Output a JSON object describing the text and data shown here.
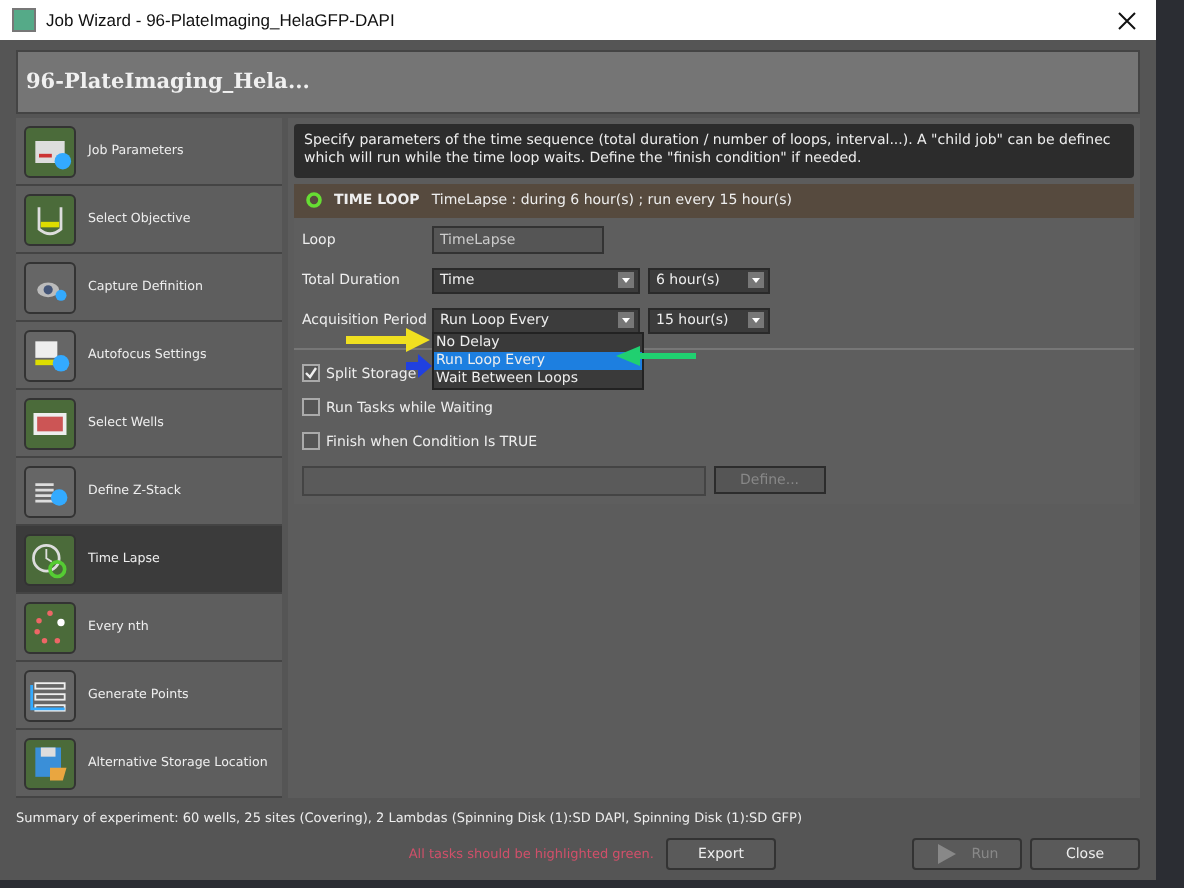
{
  "window": {
    "title": "Job Wizard - 96-PlateImaging_HelaGFP-DAPI"
  },
  "header": "96-PlateImaging_Hela...",
  "sidebar": {
    "items": [
      {
        "label": "Job Parameters",
        "complete": true,
        "selected": false
      },
      {
        "label": "Select Objective",
        "complete": true,
        "selected": false
      },
      {
        "label": "Capture Definition",
        "complete": false,
        "selected": false
      },
      {
        "label": "Autofocus Settings",
        "complete": false,
        "selected": false
      },
      {
        "label": "Select Wells",
        "complete": true,
        "selected": false
      },
      {
        "label": "Define Z-Stack",
        "complete": false,
        "selected": false
      },
      {
        "label": "Time Lapse",
        "complete": true,
        "selected": true
      },
      {
        "label": "Every nth",
        "complete": true,
        "selected": false
      },
      {
        "label": "Generate Points",
        "complete": false,
        "selected": false
      },
      {
        "label": "Alternative Storage Location",
        "complete": true,
        "selected": false
      }
    ]
  },
  "description": "Specify parameters of the time sequence (total duration / number of loops, interval...). A \"child job\" can be definec which will run while the time loop waits. Define the \"finish condition\" if needed.",
  "time_loop": {
    "heading": "TIME LOOP",
    "summary": "TimeLapse : during 6 hour(s) ; run every 15 hour(s)"
  },
  "form": {
    "loop_label": "Loop",
    "loop_value": "TimeLapse",
    "duration_label": "Total Duration",
    "duration_type": "Time",
    "duration_value": "6 hour(s)",
    "period_label": "Acquisition Period",
    "period_type": "Run Loop Every",
    "period_value": "15 hour(s)",
    "period_options": [
      {
        "label": "No Delay",
        "selected": false
      },
      {
        "label": "Run Loop Every",
        "selected": true
      },
      {
        "label": "Wait Between Loops",
        "selected": false
      }
    ],
    "checks": [
      {
        "label": "Split Storage",
        "checked": true
      },
      {
        "label": "Run Tasks while Waiting",
        "checked": false
      },
      {
        "label": "Finish when Condition Is TRUE",
        "checked": false
      }
    ],
    "define_button": {
      "label": "Define...",
      "disabled": true
    }
  },
  "summary": "Summary of experiment: 60 wells, 25 sites (Covering), 2 Lambdas (Spinning Disk (1):SD DAPI, Spinning Disk (1):SD GFP)",
  "warning": "All tasks should be highlighted green.",
  "buttons": [
    {
      "label": "Export",
      "disabled": false
    },
    {
      "label": "Run",
      "disabled": true
    },
    {
      "label": "Close",
      "disabled": false
    }
  ]
}
